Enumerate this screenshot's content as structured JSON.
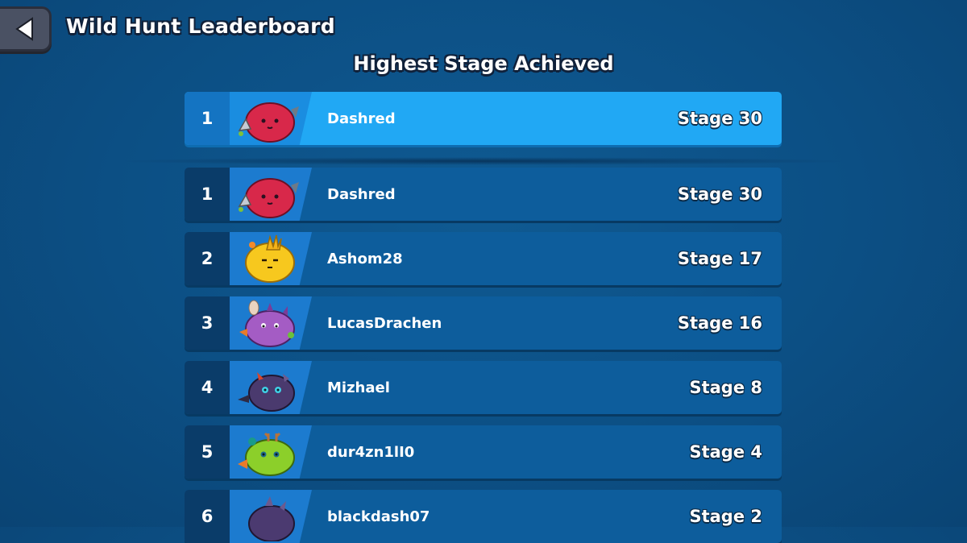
{
  "header": {
    "title": "Wild Hunt Leaderboard",
    "subtitle": "Highest Stage Achieved"
  },
  "player_entry": {
    "rank": "1",
    "name": "Dashred",
    "stage": "Stage 30",
    "axie_color": "#d8284a",
    "axie_icon": "red-axie-icon"
  },
  "leaderboard": [
    {
      "rank": "1",
      "name": "Dashred",
      "stage": "Stage 30",
      "axie_color": "#d8284a",
      "axie_icon": "red-axie-icon"
    },
    {
      "rank": "2",
      "name": "Ashom28",
      "stage": "Stage 17",
      "axie_color": "#f7c81e",
      "axie_icon": "yellow-axie-icon"
    },
    {
      "rank": "3",
      "name": "LucasDrachen",
      "stage": "Stage 16",
      "axie_color": "#a45cc4",
      "axie_icon": "purple-axie-icon"
    },
    {
      "rank": "4",
      "name": "Mizhael",
      "stage": "Stage 8",
      "axie_color": "#4a3a6e",
      "axie_icon": "dark-axie-icon"
    },
    {
      "rank": "5",
      "name": "dur4zn1lI0",
      "stage": "Stage 4",
      "axie_color": "#8ccf2a",
      "axie_icon": "green-axie-icon"
    },
    {
      "rank": "6",
      "name": "blackdash07",
      "stage": "Stage 2",
      "axie_color": "#4b3a70",
      "axie_icon": "dark-axie-icon"
    }
  ],
  "colors": {
    "background": "#0c4f84",
    "highlight_row": "#21a8f4",
    "row": "#0d5d9c"
  }
}
